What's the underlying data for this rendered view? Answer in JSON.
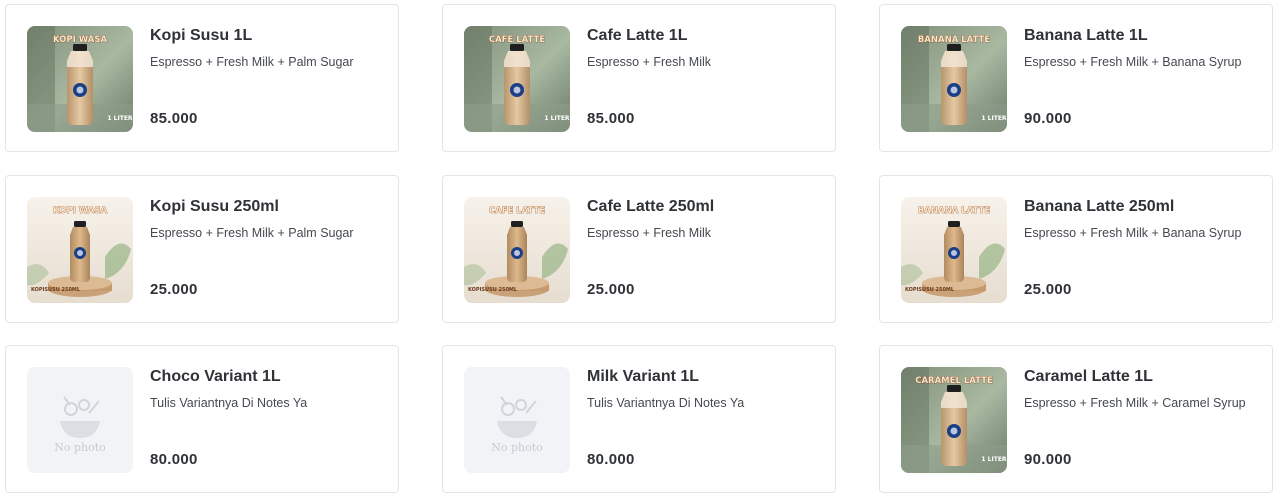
{
  "products": [
    {
      "name": "Kopi Susu 1L",
      "description": "Espresso + Fresh Milk + Palm Sugar",
      "price": "85.000",
      "photo": "bottle-1l",
      "brand": "KOPI WASA",
      "size_label": "1 LITER"
    },
    {
      "name": "Cafe Latte 1L",
      "description": "Espresso + Fresh Milk",
      "price": "85.000",
      "photo": "bottle-1l",
      "brand": "CAFE LATTE",
      "size_label": "1 LITER"
    },
    {
      "name": "Banana Latte 1L",
      "description": "Espresso + Fresh Milk + Banana Syrup",
      "price": "90.000",
      "photo": "bottle-1l",
      "brand": "BANANA LATTE",
      "size_label": "1 LITER"
    },
    {
      "name": "Kopi Susu 250ml",
      "description": "Espresso + Fresh Milk + Palm Sugar",
      "price": "25.000",
      "photo": "bottle-250ml",
      "brand": "KOPI WASA",
      "size_label": "KOPISUSU 250ML"
    },
    {
      "name": "Cafe Latte 250ml",
      "description": "Espresso + Fresh Milk",
      "price": "25.000",
      "photo": "bottle-250ml",
      "brand": "CAFE LATTE",
      "size_label": "KOPISUSU 250ML"
    },
    {
      "name": "Banana Latte 250ml",
      "description": "Espresso + Fresh Milk + Banana Syrup",
      "price": "25.000",
      "photo": "bottle-250ml",
      "brand": "BANANA LATTE",
      "size_label": "KOPISUSU 250ML"
    },
    {
      "name": "Choco Variant 1L",
      "description": "Tulis Variantnya Di Notes Ya",
      "price": "80.000",
      "photo": "none",
      "no_photo_label": "No photo"
    },
    {
      "name": "Milk Variant 1L",
      "description": "Tulis Variantnya Di Notes Ya",
      "price": "80.000",
      "photo": "none",
      "no_photo_label": "No photo"
    },
    {
      "name": "Caramel Latte 1L",
      "description": "Espresso + Fresh Milk + Caramel Syrup",
      "price": "90.000",
      "photo": "bottle-1l",
      "brand": "CARAMEL LATTE",
      "size_label": "1 LITER"
    }
  ],
  "colors": {
    "card_border": "#e4e5e7",
    "text": "#2f3237",
    "subtext": "#454950",
    "photo_bg_1l": "#8fa08a",
    "photo_bg_250ml": "#f1ebe3",
    "no_photo_bg": "#f2f3f6"
  }
}
